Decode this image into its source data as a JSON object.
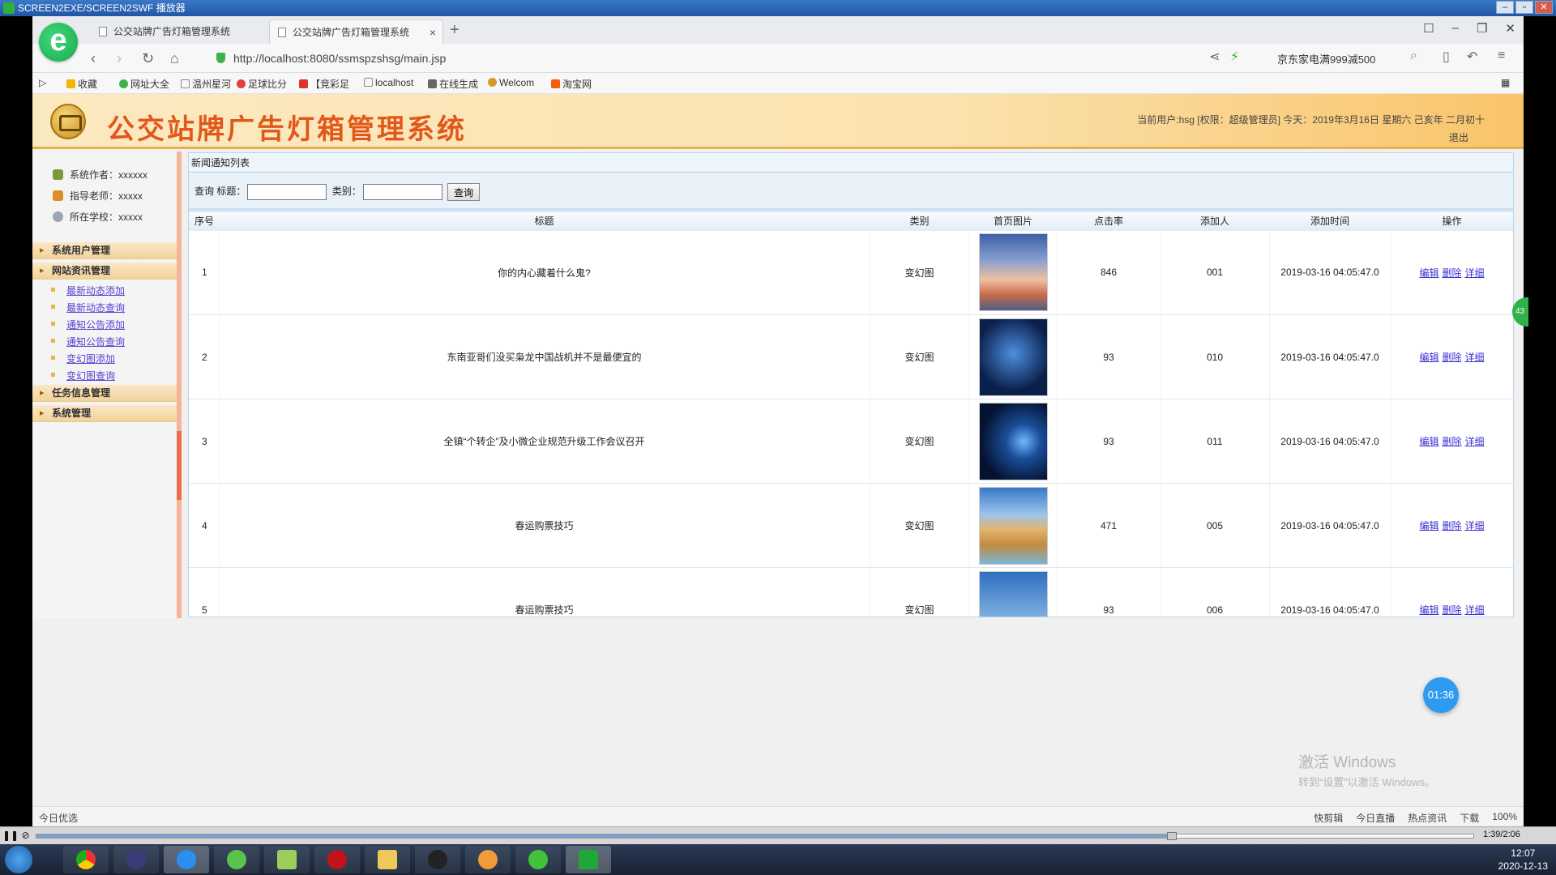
{
  "player": {
    "title": "SCREEN2EXE/SCREEN2SWF 播放器",
    "time": "1:39/2:06",
    "progress_fraction": 0.79
  },
  "browser": {
    "tabs": [
      {
        "label": "公交站牌广告灯箱管理系统",
        "active": false
      },
      {
        "label": "公交站牌广告灯箱管理系统",
        "active": true
      }
    ],
    "url": "http://localhost:8080/ssmspzshsg/main.jsp",
    "search_hint": "京东家电满999减500",
    "bookmarks": [
      "收藏",
      "网址大全",
      "温州星河",
      "足球比分",
      "【竞彩足",
      "localhost",
      "在线生成",
      "Welcom",
      "淘宝网"
    ]
  },
  "header": {
    "title": "公交站牌广告灯箱管理系统",
    "user_info": "当前用户:hsg [权限：超级管理员] 今天：2019年3月16日 星期六 己亥年 二月初十",
    "logout": "退出"
  },
  "sidebar": {
    "info": [
      {
        "label": "系统作者：xxxxxx",
        "icon": "author-icon"
      },
      {
        "label": "指导老师：xxxxx",
        "icon": "teacher-icon"
      },
      {
        "label": "所在学校：xxxxx",
        "icon": "school-icon"
      }
    ],
    "menu": [
      {
        "label": "系统用户管理"
      },
      {
        "label": "网站资讯管理",
        "items": [
          "最新动态添加",
          "最新动态查询",
          "通知公告添加",
          "通知公告查询",
          "变幻图添加",
          "变幻图查询"
        ]
      },
      {
        "label": "任务信息管理"
      },
      {
        "label": "系统管理"
      }
    ]
  },
  "main": {
    "panel_title": "新闻通知列表",
    "search": {
      "query_label": "查询",
      "title_label": "标题：",
      "category_label": "类别：",
      "button": "查询"
    },
    "columns": [
      "序号",
      "标题",
      "类别",
      "首页图片",
      "点击率",
      "添加人",
      "添加时间",
      "操作"
    ],
    "rows": [
      {
        "seq": "1",
        "title": "你的内心藏着什么鬼?",
        "category": "变幻图",
        "clicks": "846",
        "adder": "001",
        "time": "2019-03-16 04:05:47.0",
        "image": "sunset-clouds"
      },
      {
        "seq": "2",
        "title": "东南亚哥们没买枭龙中国战机并不是最便宜的",
        "category": "变幻图",
        "clicks": "93",
        "adder": "010",
        "time": "2019-03-16 04:05:47.0",
        "image": "blue-tech"
      },
      {
        "seq": "3",
        "title": "全镇“个转企”及小微企业规范升级工作会议召开",
        "category": "变幻图",
        "clicks": "93",
        "adder": "011",
        "time": "2019-03-16 04:05:47.0",
        "image": "blue-swirl"
      },
      {
        "seq": "4",
        "title": "春运购票技巧",
        "category": "变幻图",
        "clicks": "471",
        "adder": "005",
        "time": "2019-03-16 04:05:47.0",
        "image": "desert"
      },
      {
        "seq": "5",
        "title": "春运购票技巧",
        "category": "变幻图",
        "clicks": "93",
        "adder": "006",
        "time": "2019-03-16 04:05:47.0",
        "image": "sky"
      }
    ],
    "ops": [
      "编辑",
      "删除",
      "详细"
    ]
  },
  "overlay": {
    "timer": "01:36",
    "side_badge": "43",
    "watermark_line1": "激活 Windows",
    "watermark_line2": "转到“设置”以激活 Windows。"
  },
  "statusbar": {
    "left": "今日优选",
    "right": [
      "快剪辑",
      "今日直播",
      "热点资讯",
      "下载",
      "100%"
    ]
  },
  "taskbar": {
    "time": "12:07",
    "date": "2020-12-13"
  }
}
